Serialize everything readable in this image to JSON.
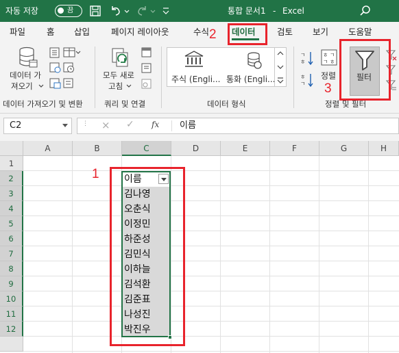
{
  "titlebar": {
    "autosave_label": "자동 저장",
    "autosave_state": "끔",
    "document_title": "통합 문서1",
    "app_name": "Excel",
    "separator": "-",
    "icons": [
      "save-icon",
      "undo-icon",
      "redo-icon",
      "customize-icon",
      "search-icon"
    ]
  },
  "tabs": [
    {
      "label": "파일"
    },
    {
      "label": "홈"
    },
    {
      "label": "삽입"
    },
    {
      "label": "페이지 레이아웃"
    },
    {
      "label": "수식"
    },
    {
      "label": "데이터",
      "active": true
    },
    {
      "label": "검토"
    },
    {
      "label": "보기"
    },
    {
      "label": "도움말"
    }
  ],
  "ribbon": {
    "get_data": {
      "line1": "데이터 가",
      "line2": "져오기"
    },
    "refresh_all": {
      "line1": "모두 새로",
      "line2": "고침"
    },
    "stocks": "주식 (Engli...",
    "currency": "통화 (Engli...",
    "sort_label": "정렬",
    "filter_label": "필터",
    "groups": {
      "get_transform": "데이터 가져오기 및 변환",
      "queries": "쿼리 및 연결",
      "data_types": "데이터 형식",
      "sort_filter": "정렬 및 필터"
    }
  },
  "formula_bar": {
    "name_box": "C2",
    "formula": "이름",
    "cancel_symbol": "×",
    "enter_symbol": "✓",
    "fx_symbol": "fx"
  },
  "grid": {
    "columns": [
      "A",
      "B",
      "C",
      "D",
      "E",
      "F",
      "G",
      "H"
    ],
    "rows": [
      "1",
      "2",
      "3",
      "4",
      "5",
      "6",
      "7",
      "8",
      "9",
      "10",
      "11",
      "12"
    ],
    "selected_column": "C",
    "header_cell": "이름",
    "names": [
      "김나영",
      "오춘식",
      "이정민",
      "하준성",
      "김민식",
      "이하늘",
      "김석환",
      "김준표",
      "나성진",
      "박진우"
    ]
  },
  "annotations": {
    "num1": "1",
    "num2": "2",
    "num3": "3",
    "color": "#e8232c"
  },
  "colors": {
    "excel_green": "#217346",
    "ribbon_bg": "#f3f3f3",
    "selection_fill": "#d9d9d9"
  }
}
